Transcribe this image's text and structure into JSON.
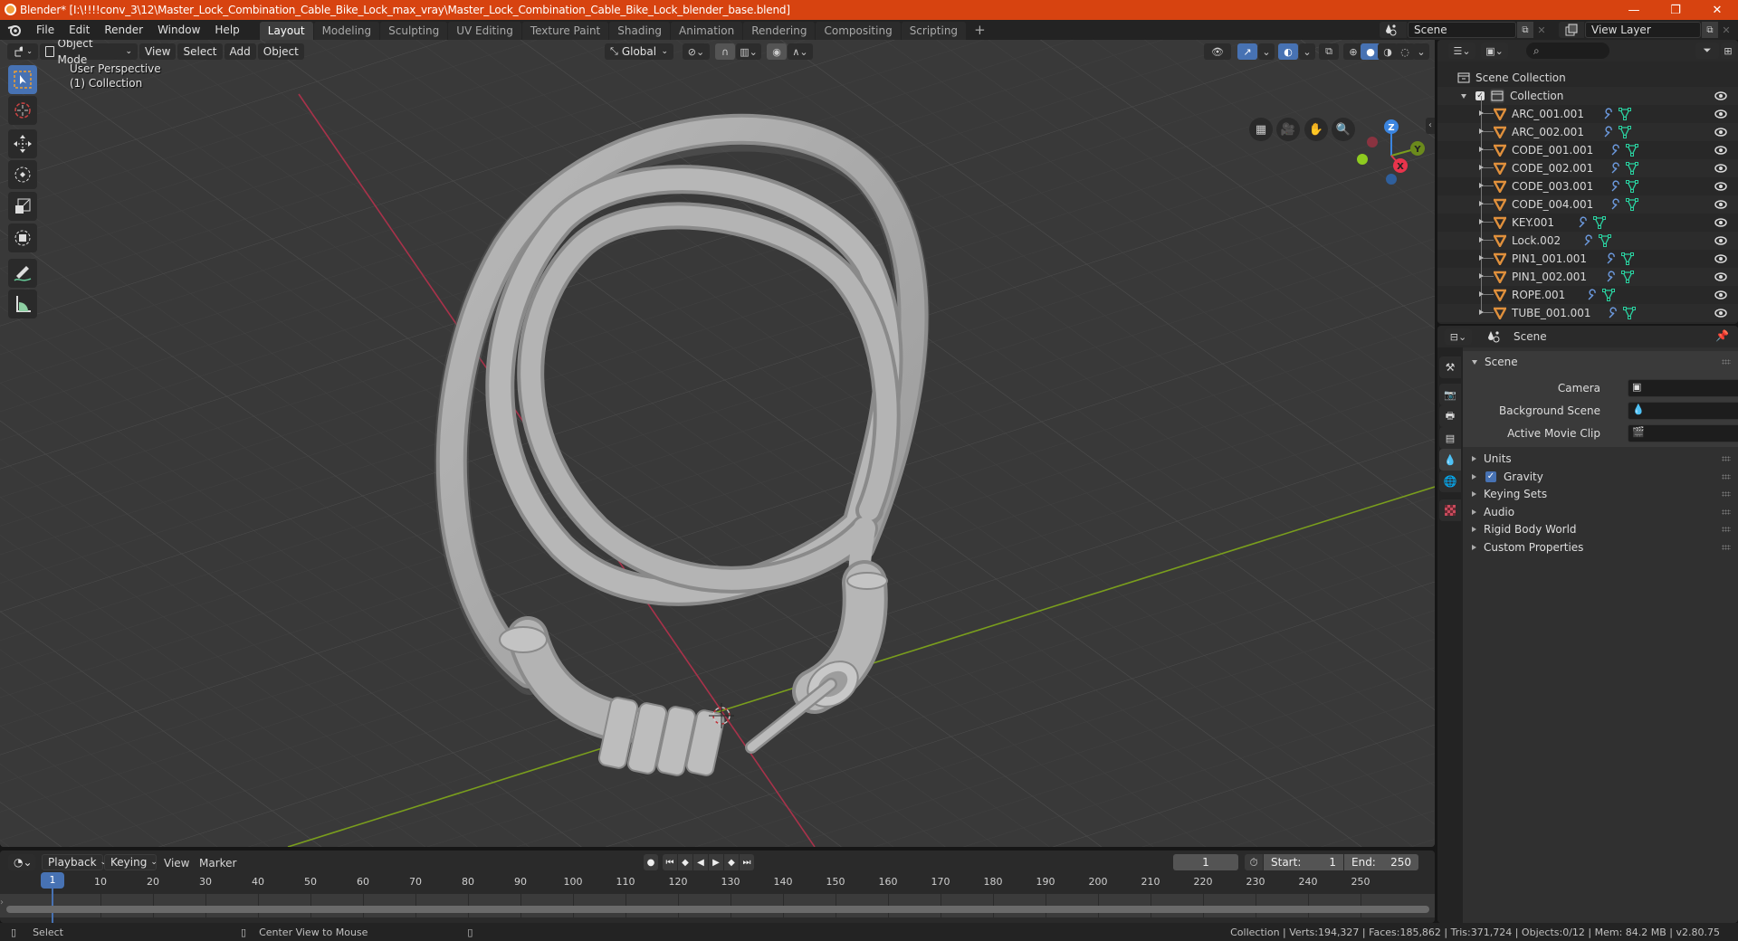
{
  "window": {
    "title": "Blender* [I:\\!!!!conv_3\\12\\Master_Lock_Combination_Cable_Bike_Lock_max_vray\\Master_Lock_Combination_Cable_Bike_Lock_blender_base.blend]",
    "controls": {
      "minimize": "—",
      "maximize": "❐",
      "close": "✕"
    }
  },
  "menubar": {
    "items": [
      "File",
      "Edit",
      "Render",
      "Window",
      "Help"
    ],
    "workspaces": [
      "Layout",
      "Modeling",
      "Sculpting",
      "UV Editing",
      "Texture Paint",
      "Shading",
      "Animation",
      "Rendering",
      "Compositing",
      "Scripting"
    ],
    "active_workspace": "Layout",
    "add_workspace": "+",
    "scene_label": "Scene",
    "view_layer_label": "View Layer"
  },
  "viewport": {
    "mode": "Object Mode",
    "menus": [
      "View",
      "Select",
      "Add",
      "Object"
    ],
    "orientation": "Global",
    "overlay_title": "User Perspective",
    "overlay_collection": "(1) Collection",
    "gizmo": {
      "z": "Z",
      "y": "Y",
      "x": "X"
    },
    "colors": {
      "x_axis": "#b0344a",
      "y_axis": "#7a9e1d",
      "accent": "#4772b3"
    }
  },
  "outliner": {
    "root": "Scene Collection",
    "collection": "Collection",
    "objects": [
      "ARC_001.001",
      "ARC_002.001",
      "CODE_001.001",
      "CODE_002.001",
      "CODE_003.001",
      "CODE_004.001",
      "KEY.001",
      "Lock.002",
      "PIN1_001.001",
      "PIN1_002.001",
      "ROPE.001",
      "TUBE_001.001"
    ]
  },
  "properties": {
    "context": "Scene",
    "panel_title": "Scene",
    "fields": [
      {
        "label": "Camera",
        "value": ""
      },
      {
        "label": "Background Scene",
        "value": ""
      },
      {
        "label": "Active Movie Clip",
        "value": ""
      }
    ],
    "subpanels": [
      "Units",
      "Gravity",
      "Keying Sets",
      "Audio",
      "Rigid Body World",
      "Custom Properties"
    ],
    "gravity_checked": true
  },
  "timeline": {
    "menus": [
      "Playback",
      "Keying",
      "View",
      "Marker"
    ],
    "current_frame": "1",
    "start_label": "Start:",
    "start": "1",
    "end_label": "End:",
    "end": "250",
    "ticks": [
      "10",
      "20",
      "30",
      "40",
      "50",
      "60",
      "70",
      "80",
      "90",
      "100",
      "110",
      "120",
      "130",
      "140",
      "150",
      "160",
      "170",
      "180",
      "190",
      "200",
      "210",
      "220",
      "230",
      "240",
      "250"
    ],
    "playhead": "1"
  },
  "statusbar": {
    "left_action": "Select",
    "middle_action": "Center View to Mouse",
    "stats": "Collection | Verts:194,327 | Faces:185,862 | Tris:371,724 | Objects:0/12 | Mem: 84.2 MB | v2.80.75"
  }
}
